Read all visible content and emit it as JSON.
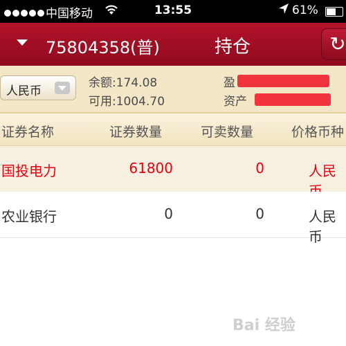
{
  "status_bar": {
    "carrier": "中国移动",
    "time": "13:55",
    "battery_percent": "61%",
    "battery_level": 0.61,
    "icons": [
      "signal-dots",
      "wifi-icon",
      "location-icon",
      "battery-icon"
    ]
  },
  "nav": {
    "account": "75804358(普)",
    "title": "持仓",
    "refresh_icon": "↻"
  },
  "summary": {
    "currency": "人民币",
    "balance_label": "余额:174.08",
    "available_label": "可用:1004.70",
    "pnl_label": "盈",
    "assets_label": "资产"
  },
  "table": {
    "headers": [
      "证券名称",
      "证券数量",
      "可卖数量",
      "价格币种"
    ],
    "rows": [
      {
        "name": "国投电力",
        "quantity": "61800",
        "sellable": "0",
        "currency": "人民币"
      },
      {
        "name": "农业银行",
        "quantity": "0",
        "sellable": "0",
        "currency": "人民币"
      }
    ]
  },
  "watermark": "Bai 经验",
  "colors": {
    "nav_bg": "#a0102a",
    "summary_bg": "#f3e7c8",
    "accent_red": "#e60012"
  }
}
